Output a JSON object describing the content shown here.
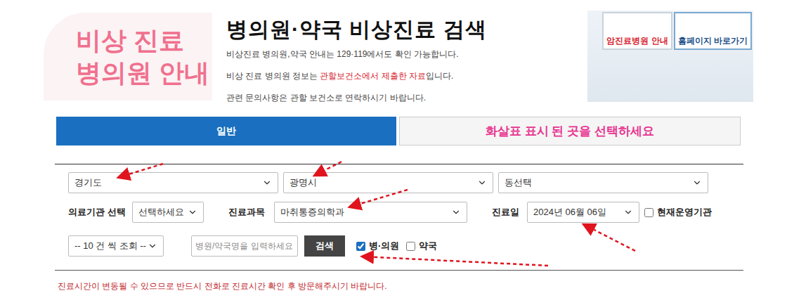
{
  "logo": {
    "lines": [
      "비상 진료",
      "병의원 안내"
    ]
  },
  "header": {
    "title": "병의원·약국 비상진료 검색",
    "lines": [
      [
        {
          "text": "비상진료 병의원,약국 안내는 129·119에서도 확인 가능합니다.",
          "highlight": false
        }
      ],
      [
        {
          "text": "비상 진료 병의원 정보는 ",
          "highlight": false
        },
        {
          "text": "관할보건소에서 제출한 자료",
          "highlight": true
        },
        {
          "text": "입니다.",
          "highlight": false
        }
      ],
      [
        {
          "text": "관련 문의사항은 관할 보건소로 연락하시기 바랍니다.",
          "highlight": false
        }
      ]
    ]
  },
  "banner": {
    "links": [
      "암진료병원 안내",
      "홈페이지 바로가기"
    ]
  },
  "tabs": [
    {
      "label": "일반",
      "selected": true,
      "annotation": false
    },
    {
      "label": "화살표 표시 된 곳을 선택하세요",
      "selected": false,
      "annotation": true
    }
  ],
  "region": [
    "경기도",
    "광명시",
    "동선택"
  ],
  "filters": {
    "institution": {
      "label": "의료기관 선택",
      "value": "선택하세요"
    },
    "department": {
      "label": "진료과목",
      "value": "마취통증의학과"
    },
    "date": {
      "label": "진료일",
      "value": "2024년 06월 06일"
    },
    "openNow": {
      "label": "현재운영기관",
      "checked": false
    }
  },
  "pageSize": "-- 10 건 씩 조회 --",
  "searchInput": {
    "placeholder": "병원/약국명을 입력하세요"
  },
  "searchButton": "검색",
  "types": [
    {
      "label": "병·의원",
      "checked": true
    },
    {
      "label": "약국",
      "checked": false
    }
  ],
  "notice": "진료시간이 변동될 수 있으므로 반드시 전화로 진료시간 확인 후 방문해주시기 바랍니다."
}
